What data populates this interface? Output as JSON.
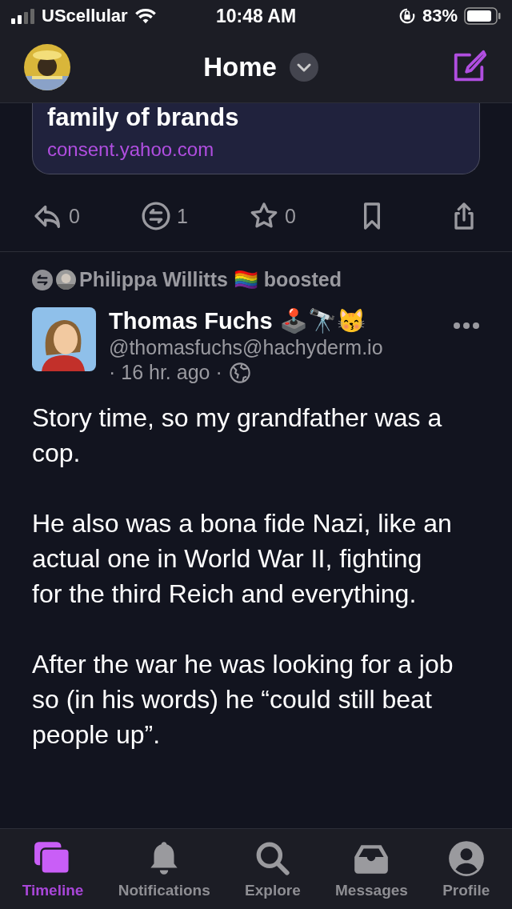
{
  "status_bar": {
    "carrier": "UScellular",
    "time": "10:48 AM",
    "battery": "83%"
  },
  "header": {
    "title": "Home"
  },
  "link_card": {
    "title": "family of brands",
    "url": "consent.yahoo.com"
  },
  "actions": [
    {
      "kind": "reply",
      "count": "0"
    },
    {
      "kind": "boost",
      "count": "1"
    },
    {
      "kind": "favorite",
      "count": "0"
    },
    {
      "kind": "bookmark"
    },
    {
      "kind": "share"
    }
  ],
  "post": {
    "booster": "Philippa Willitts",
    "booster_emoji": "🏳️‍🌈",
    "boost_label": "boosted",
    "author": "Thomas Fuchs",
    "author_emoji": "🕹️🔭😽",
    "handle": "@thomasfuchs@hachyderm.io",
    "time": "· 16 hr. ago ·",
    "paragraphs": [
      "Story time, so my grandfather was a cop.",
      "He also was a bona fide Nazi, like an actual one in World War II, fighting for the third Reich and everything.",
      "After the war he was looking for a job so (in his words) he “could still beat people up”."
    ]
  },
  "tabs": [
    {
      "kind": "timeline",
      "label": "Timeline",
      "selected": true
    },
    {
      "kind": "notifications",
      "label": "Notifications",
      "selected": false
    },
    {
      "kind": "explore",
      "label": "Explore",
      "selected": false
    },
    {
      "kind": "messages",
      "label": "Messages",
      "selected": false
    },
    {
      "kind": "profile",
      "label": "Profile",
      "selected": false
    }
  ]
}
